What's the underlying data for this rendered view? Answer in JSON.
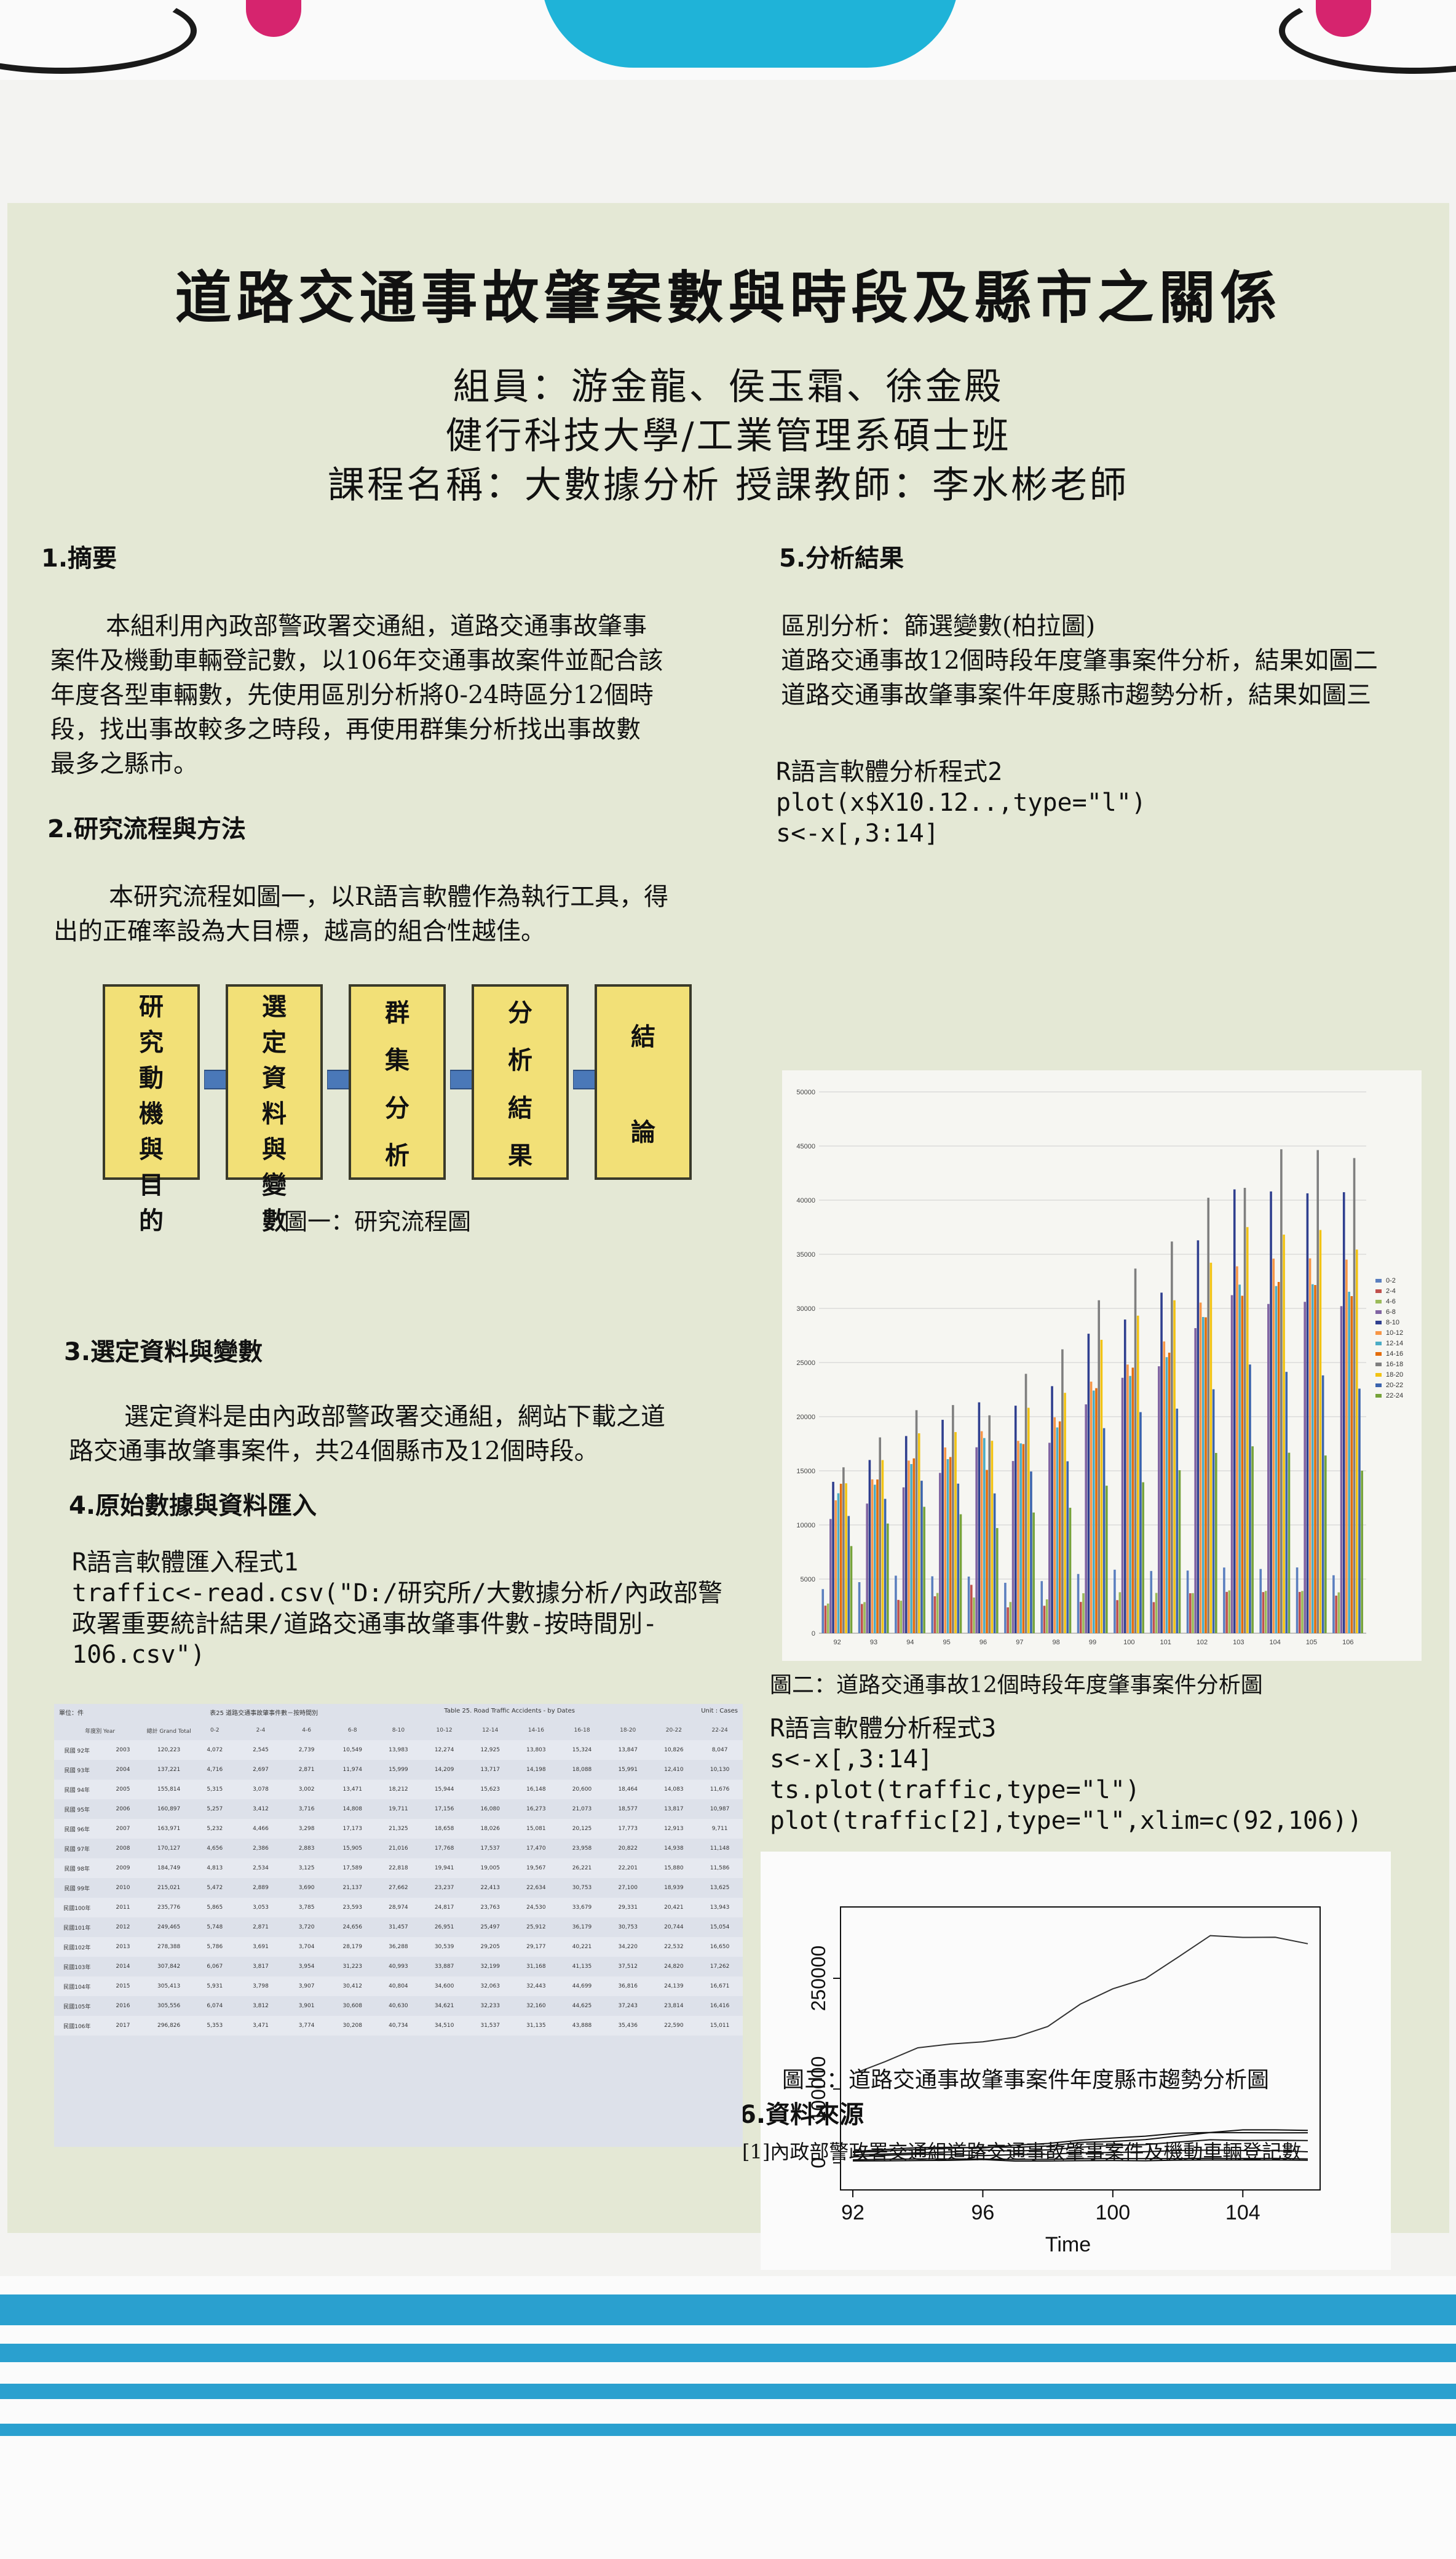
{
  "poster": {
    "title": "道路交通事故肇案數與時段及縣市之關係",
    "members": "組員：游金龍、侯玉霜、徐金殿",
    "school": "健行科技大學/工業管理系碩士班",
    "course": "課程名稱：大數據分析 授課教師：李水彬老師"
  },
  "sections": {
    "s1": {
      "heading": "1.摘要",
      "lines": [
        "本組利用內政部警政署交通組，道路交通事故肇事",
        "案件及機動車輛登記數，以106年交通事故案件並配合該",
        "年度各型車輛數，先使用區別分析將0-24時區分12個時",
        "段，找出事故較多之時段，再使用群集分析找出事故數",
        "最多之縣市。"
      ]
    },
    "s2": {
      "heading": "2.研究流程與方法",
      "lines": [
        "本研究流程如圖一，以R語言軟體作為執行工具，得",
        "出的正確率設為大目標，越高的組合性越佳。"
      ]
    },
    "flow": {
      "boxes": [
        [
          "研",
          "究",
          "動",
          "機",
          "與",
          "目",
          "的"
        ],
        [
          "選",
          "定",
          "資",
          "料",
          "與",
          "變",
          "數"
        ],
        [
          "群",
          "集",
          "分",
          "析"
        ],
        [
          "分",
          "析",
          "結",
          "果"
        ],
        [
          "結",
          "論"
        ]
      ],
      "caption": "圖一：研究流程圖"
    },
    "s3": {
      "heading": "3.選定資料與變數",
      "lines": [
        "選定資料是由內政部警政署交通組，網站下載之道",
        "路交通事故肇事案件，共24個縣市及12個時段。"
      ]
    },
    "s4": {
      "heading": "4.原始數據與資料匯入",
      "code": [
        "R語言軟體匯入程式1",
        "traffic<-read.csv(\"D:/研究所/大數據分析/內政部警",
        "政署重要統計結果/道路交通事故肇事件數-按時間別-",
        "106.csv\")"
      ]
    },
    "s5": {
      "heading": "5.分析結果",
      "lines": [
        "區別分析：篩選變數(柏拉圖)",
        "道路交通事故12個時段年度肇事案件分析，結果如圖二",
        "道路交通事故肇事案件年度縣市趨勢分析，結果如圖三"
      ],
      "code2": [
        "R語言軟體分析程式2",
        "plot(x$X10.12..,type=\"l\")",
        "s<-x[,3:14]"
      ],
      "caption2": "圖二：道路交通事故12個時段年度肇事案件分析圖",
      "code3": [
        "R語言軟體分析程式3",
        "s<-x[,3:14]",
        "ts.plot(traffic,type=\"l\")",
        "plot(traffic[2],type=\"l\",xlim=c(92,106))"
      ],
      "caption3": "圖三：道路交通事故肇事案件年度縣市趨勢分析圖"
    },
    "s6": {
      "heading": "6.資料來源",
      "ref": "[1]內政部警政署交通組道路交通事故肇事案件及機動車輛登記數"
    }
  },
  "table": {
    "caption_left": "單位：件",
    "caption_mid": "表25 道路交通事故肇事件數－按時間別",
    "caption_right": "Table 25. Road Traffic Accidents - by Dates",
    "unit": "Unit : Cases",
    "columns": [
      "年度別 Year",
      "總計 Grand Total",
      "0-2",
      "2-4",
      "4-6",
      "6-8",
      "8-10",
      "10-12",
      "12-14",
      "14-16",
      "16-18",
      "18-20",
      "20-22",
      "22-24"
    ],
    "rows": [
      [
        "民國 92年",
        "2003",
        "120,223",
        "4,072",
        "2,545",
        "2,739",
        "10,549",
        "13,983",
        "12,274",
        "12,925",
        "13,803",
        "15,324",
        "13,847",
        "10,826",
        "8,047"
      ],
      [
        "民國 93年",
        "2004",
        "137,221",
        "4,716",
        "2,697",
        "2,871",
        "11,974",
        "15,999",
        "14,209",
        "13,717",
        "14,198",
        "18,088",
        "15,991",
        "12,410",
        "10,130"
      ],
      [
        "民國 94年",
        "2005",
        "155,814",
        "5,315",
        "3,078",
        "3,002",
        "13,471",
        "18,212",
        "15,944",
        "15,623",
        "16,148",
        "20,600",
        "18,464",
        "14,083",
        "11,676"
      ],
      [
        "民國 95年",
        "2006",
        "160,897",
        "5,257",
        "3,412",
        "3,716",
        "14,808",
        "19,711",
        "17,156",
        "16,080",
        "16,273",
        "21,073",
        "18,577",
        "13,817",
        "10,987"
      ],
      [
        "民國 96年",
        "2007",
        "163,971",
        "5,232",
        "4,466",
        "3,298",
        "17,173",
        "21,325",
        "18,658",
        "18,026",
        "15,081",
        "20,125",
        "17,773",
        "12,913",
        "9,711"
      ],
      [
        "民國 97年",
        "2008",
        "170,127",
        "4,656",
        "2,386",
        "2,883",
        "15,905",
        "21,016",
        "17,768",
        "17,537",
        "17,470",
        "23,958",
        "20,822",
        "14,938",
        "11,148"
      ],
      [
        "民國 98年",
        "2009",
        "184,749",
        "4,813",
        "2,534",
        "3,125",
        "17,589",
        "22,818",
        "19,941",
        "19,005",
        "19,567",
        "26,221",
        "22,201",
        "15,880",
        "11,586"
      ],
      [
        "民國 99年",
        "2010",
        "215,021",
        "5,472",
        "2,889",
        "3,690",
        "21,137",
        "27,662",
        "23,237",
        "22,413",
        "22,634",
        "30,753",
        "27,100",
        "18,939",
        "13,625"
      ],
      [
        "民國100年",
        "2011",
        "235,776",
        "5,865",
        "3,053",
        "3,785",
        "23,593",
        "28,974",
        "24,817",
        "23,763",
        "24,530",
        "33,679",
        "29,331",
        "20,421",
        "13,943"
      ],
      [
        "民國101年",
        "2012",
        "249,465",
        "5,748",
        "2,871",
        "3,720",
        "24,656",
        "31,457",
        "26,951",
        "25,497",
        "25,912",
        "36,179",
        "30,753",
        "20,744",
        "15,054"
      ],
      [
        "民國102年",
        "2013",
        "278,388",
        "5,786",
        "3,691",
        "3,704",
        "28,179",
        "36,288",
        "30,539",
        "29,205",
        "29,177",
        "40,221",
        "34,220",
        "22,532",
        "16,650"
      ],
      [
        "民國103年",
        "2014",
        "307,842",
        "6,067",
        "3,817",
        "3,954",
        "31,223",
        "40,993",
        "33,887",
        "32,199",
        "31,168",
        "41,135",
        "37,512",
        "24,820",
        "17,262"
      ],
      [
        "民國104年",
        "2015",
        "305,413",
        "5,931",
        "3,798",
        "3,907",
        "30,412",
        "40,804",
        "34,600",
        "32,063",
        "32,443",
        "44,699",
        "36,816",
        "24,139",
        "16,671"
      ],
      [
        "民國105年",
        "2016",
        "305,556",
        "6,074",
        "3,812",
        "3,901",
        "30,608",
        "40,630",
        "34,621",
        "32,233",
        "32,160",
        "44,625",
        "37,243",
        "23,814",
        "16,416"
      ],
      [
        "民國106年",
        "2017",
        "296,826",
        "5,353",
        "3,471",
        "3,774",
        "30,208",
        "40,734",
        "34,510",
        "31,537",
        "31,135",
        "43,888",
        "35,436",
        "22,590",
        "15,011"
      ]
    ]
  },
  "chart_data": [
    {
      "type": "bar",
      "title": "",
      "categories": [
        "92",
        "93",
        "94",
        "95",
        "96",
        "97",
        "98",
        "99",
        "100",
        "101",
        "102",
        "103",
        "104",
        "105",
        "106"
      ],
      "ylim": [
        0,
        50000
      ],
      "yticks": [
        "0",
        "5000",
        "10000",
        "15000",
        "20000",
        "25000",
        "30000",
        "35000",
        "40000",
        "45000",
        "50000"
      ],
      "legend_position": "right",
      "series": [
        {
          "name": "0-2",
          "color": "#5b7fbf",
          "values": [
            4072,
            4716,
            5315,
            5257,
            5232,
            4656,
            4813,
            5472,
            5865,
            5748,
            5786,
            6067,
            5931,
            6074,
            5353
          ]
        },
        {
          "name": "2-4",
          "color": "#c0504d",
          "values": [
            2545,
            2697,
            3078,
            3412,
            4466,
            2386,
            2534,
            2889,
            3053,
            2871,
            3691,
            3817,
            3798,
            3812,
            3471
          ]
        },
        {
          "name": "4-6",
          "color": "#9bbb59",
          "values": [
            2739,
            2871,
            3002,
            3716,
            3298,
            2883,
            3125,
            3690,
            3785,
            3720,
            3704,
            3954,
            3907,
            3901,
            3774
          ]
        },
        {
          "name": "6-8",
          "color": "#8064a2",
          "values": [
            10549,
            11974,
            13471,
            14808,
            17173,
            15905,
            17589,
            21137,
            23593,
            24656,
            28179,
            31223,
            30412,
            30608,
            30208
          ]
        },
        {
          "name": "8-10",
          "color": "#2f3f8f",
          "values": [
            13983,
            15999,
            18212,
            19711,
            21325,
            21016,
            22818,
            27662,
            28974,
            31457,
            36288,
            40993,
            40804,
            40630,
            40734
          ]
        },
        {
          "name": "10-12",
          "color": "#f79646",
          "values": [
            12274,
            14209,
            15944,
            17156,
            18658,
            17768,
            19941,
            23237,
            24817,
            26951,
            30539,
            33887,
            34600,
            34621,
            34510
          ]
        },
        {
          "name": "12-14",
          "color": "#4bacc6",
          "values": [
            12925,
            13717,
            15623,
            16080,
            18026,
            17537,
            19005,
            22413,
            23763,
            25497,
            29205,
            32199,
            32063,
            32233,
            31537
          ]
        },
        {
          "name": "14-16",
          "color": "#e46c0a",
          "values": [
            13803,
            14198,
            16148,
            16273,
            15081,
            17470,
            19567,
            22634,
            24530,
            25912,
            29177,
            31168,
            32443,
            32160,
            31135
          ]
        },
        {
          "name": "16-18",
          "color": "#7f7f7f",
          "values": [
            15324,
            18088,
            20600,
            21073,
            20125,
            23958,
            26221,
            30753,
            33679,
            36179,
            40221,
            41135,
            44699,
            44625,
            43888
          ]
        },
        {
          "name": "18-20",
          "color": "#f2c314",
          "values": [
            13847,
            15991,
            18464,
            18577,
            17773,
            20822,
            22201,
            27100,
            29331,
            30753,
            34220,
            37512,
            36816,
            37243,
            35436
          ]
        },
        {
          "name": "20-22",
          "color": "#3b64ad",
          "values": [
            10826,
            12410,
            14083,
            13817,
            12913,
            14938,
            15880,
            18939,
            20421,
            20744,
            22532,
            24820,
            24139,
            23814,
            22590
          ]
        },
        {
          "name": "22-24",
          "color": "#76a33a",
          "values": [
            8047,
            10130,
            11676,
            10987,
            9711,
            11148,
            11586,
            13625,
            13943,
            15054,
            16650,
            17262,
            16671,
            16416,
            15011
          ]
        }
      ]
    },
    {
      "type": "line",
      "title": "",
      "xlabel": "Time",
      "ylabel": "",
      "x": [
        92,
        93,
        94,
        95,
        96,
        97,
        98,
        99,
        100,
        101,
        102,
        103,
        104,
        105,
        106
      ],
      "xticks": [
        "92",
        "96",
        "100",
        "104"
      ],
      "yticks": [
        "0",
        "100000",
        "250000"
      ],
      "ylim": [
        -20000,
        330000
      ],
      "series": [
        {
          "name": "",
          "values": [
            120223,
            137221,
            155814,
            160897,
            163971,
            170127,
            184749,
            215021,
            235776,
            249465,
            278388,
            307842,
            305413,
            305556,
            296826
          ]
        },
        {
          "name": "",
          "values": [
            13983,
            15999,
            18212,
            19711,
            21325,
            21016,
            22818,
            27662,
            28974,
            31457,
            36288,
            40993,
            40804,
            40630,
            40734
          ]
        },
        {
          "name": "",
          "values": [
            15324,
            18088,
            20600,
            21073,
            20125,
            23958,
            26221,
            30753,
            33679,
            36179,
            40221,
            41135,
            44699,
            44625,
            43888
          ]
        },
        {
          "name": "",
          "values": [
            10549,
            11974,
            13471,
            14808,
            17173,
            15905,
            17589,
            21137,
            23593,
            24656,
            28179,
            31223,
            30412,
            30608,
            30208
          ]
        },
        {
          "name": "",
          "values": [
            8047,
            10130,
            11676,
            10987,
            9711,
            11148,
            11586,
            13625,
            13943,
            15054,
            16650,
            17262,
            16671,
            16416,
            15011
          ]
        },
        {
          "name": "",
          "values": [
            4072,
            4716,
            5315,
            5257,
            5232,
            4656,
            4813,
            5472,
            5865,
            5748,
            5786,
            6067,
            5931,
            6074,
            5353
          ]
        },
        {
          "name": "",
          "values": [
            2545,
            2697,
            3078,
            3412,
            4466,
            2386,
            2534,
            2889,
            3053,
            2871,
            3691,
            3817,
            3798,
            3812,
            3471
          ]
        }
      ]
    }
  ]
}
